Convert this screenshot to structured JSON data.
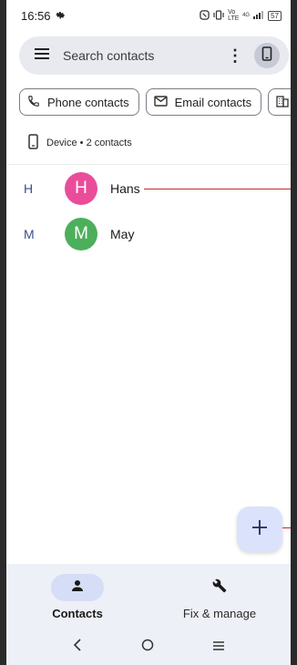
{
  "status_bar": {
    "time": "16:56",
    "network_label": "Vo LTE",
    "signal_label": "4G",
    "battery": "57"
  },
  "search": {
    "placeholder": "Search contacts"
  },
  "filter_chips": [
    {
      "label": "Phone contacts",
      "icon": "phone-icon"
    },
    {
      "label": "Email contacts",
      "icon": "email-icon"
    },
    {
      "label": "",
      "icon": "business-icon"
    }
  ],
  "account": {
    "label": "Device • 2 contacts"
  },
  "contacts": [
    {
      "section": "H",
      "initial": "H",
      "name": "Hans",
      "color": "#ea4c9a"
    },
    {
      "section": "M",
      "initial": "M",
      "name": "May",
      "color": "#4caf5c"
    }
  ],
  "bottom_nav": {
    "items": [
      {
        "label": "Contacts",
        "icon": "person-icon",
        "active": true
      },
      {
        "label": "Fix & manage",
        "icon": "wrench-icon",
        "active": false
      }
    ]
  },
  "colors": {
    "accent": "#3a4d8f",
    "fab_bg": "#dbe2fb",
    "nav_bg": "#eef0f7"
  }
}
